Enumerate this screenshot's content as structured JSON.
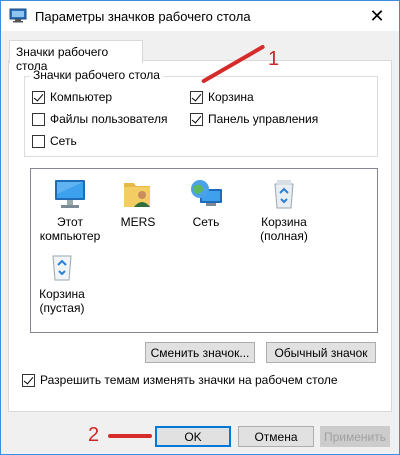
{
  "window": {
    "title": "Параметры значков рабочего стола"
  },
  "tab": {
    "label": "Значки рабочего стола"
  },
  "group": {
    "title": "Значки рабочего стола",
    "checkboxes": [
      {
        "label": "Компьютер",
        "checked": true
      },
      {
        "label": "Корзина",
        "checked": true
      },
      {
        "label": "Файлы пользователя",
        "checked": false
      },
      {
        "label": "Панель управления",
        "checked": true
      },
      {
        "label": "Сеть",
        "checked": false
      }
    ]
  },
  "icons": [
    {
      "label": "Этот\nкомпьютер",
      "icon": "computer-icon"
    },
    {
      "label": "MERS",
      "icon": "user-folder-icon"
    },
    {
      "label": "Сеть",
      "icon": "network-globe-icon"
    },
    {
      "label": "Корзина\n(полная)",
      "icon": "recycle-bin-full-icon"
    },
    {
      "label": "Корзина\n(пустая)",
      "icon": "recycle-bin-empty-icon"
    }
  ],
  "buttons": {
    "change_icon": "Сменить значок...",
    "default_icon": "Обычный значок",
    "ok": "OK",
    "cancel": "Отмена",
    "apply": "Применить"
  },
  "theme_checkbox": {
    "label": "Разрешить темам изменять значки на рабочем столе",
    "checked": true
  },
  "annotations": {
    "one": "1",
    "two": "2",
    "color": "#d52b2b"
  }
}
